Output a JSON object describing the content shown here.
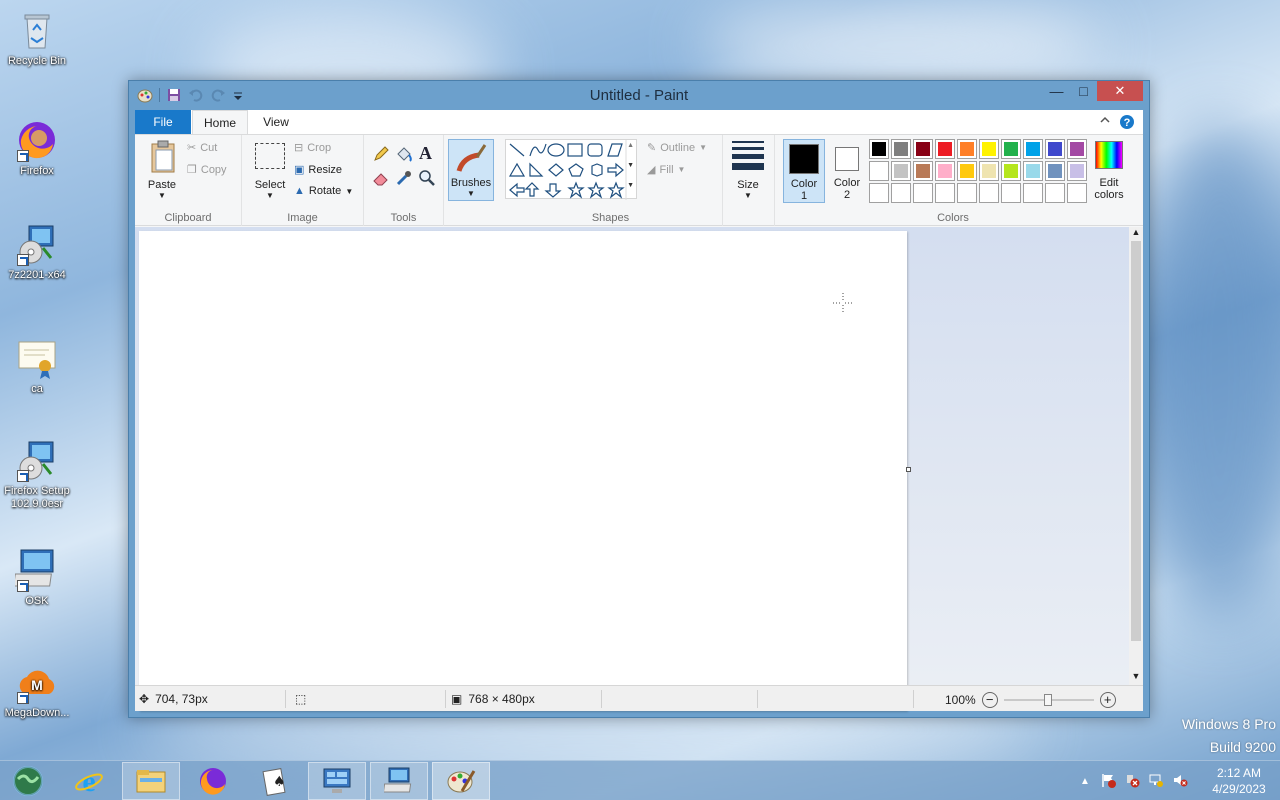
{
  "desktop": {
    "icons": [
      {
        "label": "Recycle Bin"
      },
      {
        "label": "Firefox"
      },
      {
        "label": "7z2201-x64"
      },
      {
        "label": "ca"
      },
      {
        "label": "Firefox Setup 102.9.0esr"
      },
      {
        "label": "OSK"
      },
      {
        "label": "MegaDown..."
      }
    ],
    "watermark": {
      "line1": "Windows 8 Pro",
      "line2": "Build 9200"
    }
  },
  "window": {
    "title": "Untitled - Paint",
    "tabs": {
      "file": "File",
      "home": "Home",
      "view": "View"
    },
    "ribbon": {
      "clipboard": {
        "group": "Clipboard",
        "paste": "Paste",
        "cut": "Cut",
        "copy": "Copy"
      },
      "image": {
        "group": "Image",
        "select": "Select",
        "crop": "Crop",
        "resize": "Resize",
        "rotate": "Rotate"
      },
      "tools": {
        "group": "Tools"
      },
      "brushes": {
        "label": "Brushes"
      },
      "shapes": {
        "group": "Shapes",
        "outline": "Outline",
        "fill": "Fill"
      },
      "size": {
        "label": "Size"
      },
      "colors": {
        "group": "Colors",
        "color1": "Color",
        "color1_num": "1",
        "color2": "Color",
        "color2_num": "2",
        "edit1": "Edit",
        "edit2": "colors",
        "color1_value": "#000000",
        "color2_value": "#ffffff",
        "palette_row1": [
          "#000000",
          "#7f7f7f",
          "#880015",
          "#ed1c24",
          "#ff7f27",
          "#fff200",
          "#22b14c",
          "#00a2e8",
          "#3f48cc",
          "#a349a4"
        ],
        "palette_row2": [
          "#ffffff",
          "#c3c3c3",
          "#b97a57",
          "#ffaec9",
          "#ffc90e",
          "#efe4b0",
          "#b5e61d",
          "#99d9ea",
          "#7092be",
          "#c8bfe7"
        ]
      }
    },
    "status": {
      "position": "704, 73px",
      "canvas_size": "768 × 480px",
      "zoom": "100%"
    }
  },
  "taskbar": {
    "time": "2:12 AM",
    "date": "4/29/2023"
  }
}
